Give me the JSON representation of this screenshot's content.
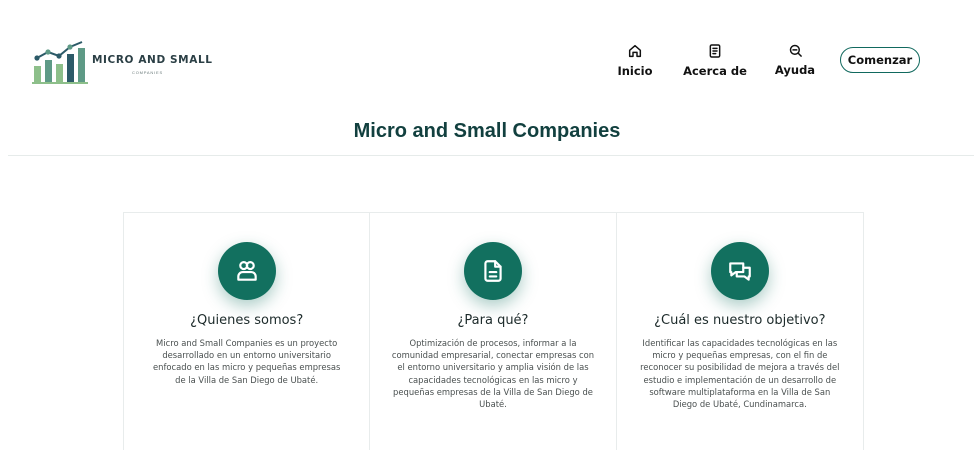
{
  "logo": {
    "title": "MICRO AND SMALL",
    "subtitle": "COMPANIES"
  },
  "nav": {
    "items": [
      {
        "label": "Inicio",
        "icon": "home-icon"
      },
      {
        "label": "Acerca de",
        "icon": "document-icon"
      },
      {
        "label": "Ayuda",
        "icon": "search-icon"
      }
    ],
    "cta_label": "Comenzar"
  },
  "page": {
    "title": "Micro and Small Companies"
  },
  "cards": [
    {
      "icon": "users-icon",
      "title": "¿Quienes somos?",
      "text": "Micro and Small Companies es un proyecto desarrollado en un entorno universitario enfocado en las micro y pequeñas empresas de la Villa de San Diego de Ubaté."
    },
    {
      "icon": "file-text-icon",
      "title": "¿Para qué?",
      "text": "Optimización de procesos, informar a la comunidad empresarial, conectar empresas con el entorno universitario y amplia visión de las capacidades tecnológicas en las micro y pequeñas empresas de la Villa de San Diego de Ubaté."
    },
    {
      "icon": "chat-icon",
      "title": "¿Cuál es nuestro objetivo?",
      "text": "Identificar las capacidades tecnológicas en las micro y pequeñas empresas, con el fin de reconocer su posibilidad de mejora a través del estudio e implementación de un desarrollo de software multiplataforma en la Villa de San Diego de Ubaté, Cundinamarca."
    }
  ],
  "colors": {
    "accent": "#12705f",
    "title": "#12403f"
  }
}
